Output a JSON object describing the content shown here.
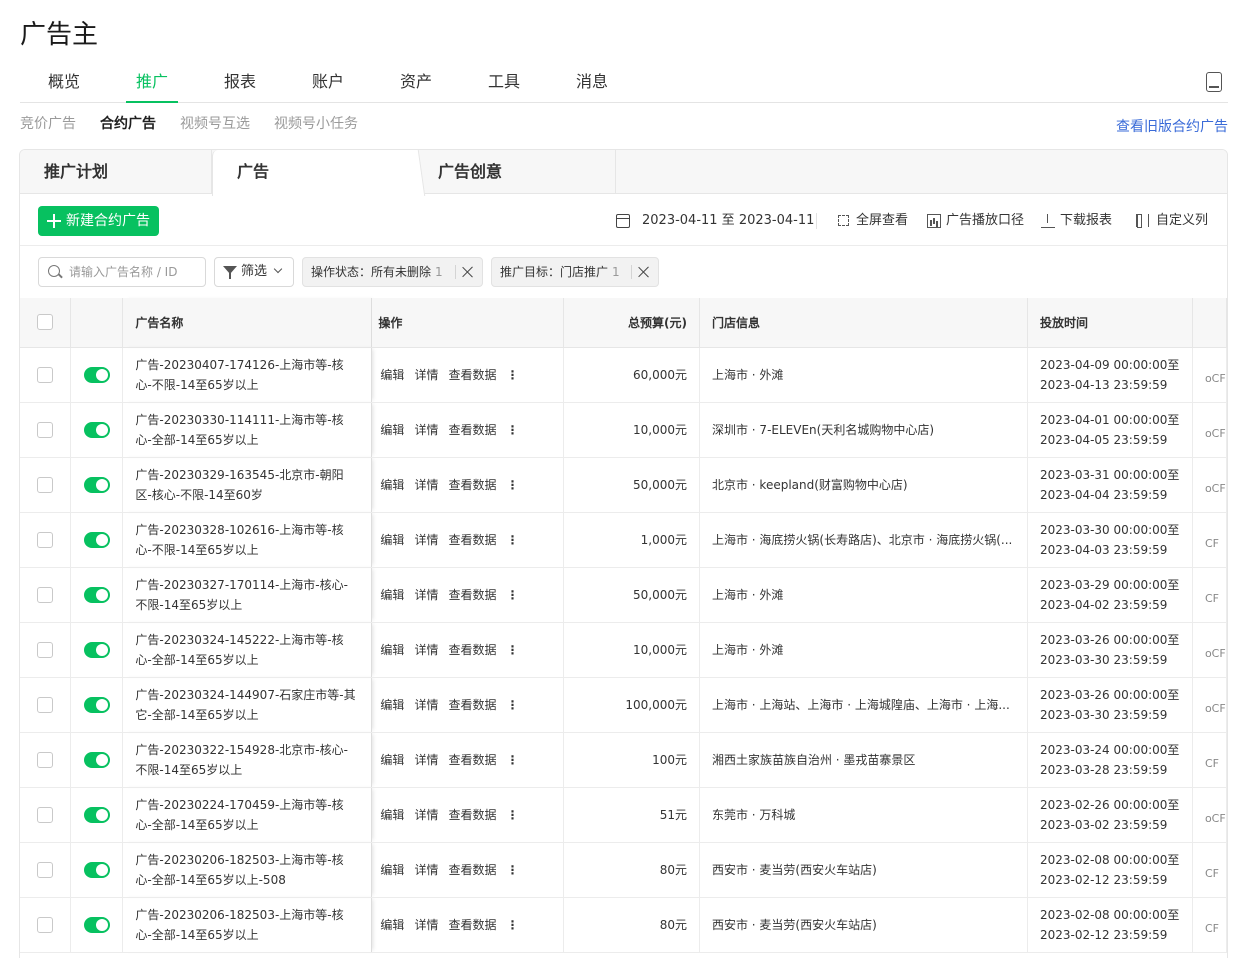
{
  "app_title": "广告主",
  "main_nav": [
    "概览",
    "推广",
    "报表",
    "账户",
    "资产",
    "工具",
    "消息"
  ],
  "sub_nav": [
    "竞价广告",
    "合约广告",
    "视频号互选",
    "视频号小任务"
  ],
  "old_link": "查看旧版合约广告",
  "tabs": [
    "推广计划",
    "广告",
    "广告创意"
  ],
  "toolbar": {
    "new_button": "新建合约广告",
    "date_range": "2023-04-11 至 2023-04-11",
    "fullscreen": "全屏查看",
    "playback": "广告播放口径",
    "download": "下载报表",
    "custom_cols": "自定义列"
  },
  "filters": {
    "search_placeholder": "请输入广告名称 / ID",
    "filter_label": "筛选",
    "tag1_label": "操作状态：所有未删除",
    "tag1_count": "1",
    "tag2_label": "推广目标：门店推广",
    "tag2_count": "1"
  },
  "columns": {
    "name": "广告名称",
    "ops": "操作",
    "budget": "总预算(元)",
    "store": "门店信息",
    "time": "投放时间"
  },
  "ops_labels": [
    "编辑",
    "详情",
    "查看数据",
    "⋮"
  ],
  "rows": [
    {
      "name": "广告-20230407-174126-上海市等-核心-不限-14至65岁以上",
      "budget": "60,000元",
      "store": "上海市 · 外滩",
      "start": "2023-04-09 00:00:00至",
      "end": "2023-04-13 23:59:59",
      "tail": "oCF"
    },
    {
      "name": "广告-20230330-114111-上海市等-核心-全部-14至65岁以上",
      "budget": "10,000元",
      "store": "深圳市 · 7-ELEVEn(天利名城购物中心店)",
      "start": "2023-04-01 00:00:00至",
      "end": "2023-04-05 23:59:59",
      "tail": "oCF"
    },
    {
      "name": "广告-20230329-163545-北京市-朝阳区-核心-不限-14至60岁",
      "budget": "50,000元",
      "store": "北京市 · keepland(财富购物中心店)",
      "start": "2023-03-31 00:00:00至",
      "end": "2023-04-04 23:59:59",
      "tail": "oCF"
    },
    {
      "name": "广告-20230328-102616-上海市等-核心-不限-14至65岁以上",
      "budget": "1,000元",
      "store": "上海市 · 海底捞火锅(长寿路店)、北京市 · 海底捞火锅(...",
      "start": "2023-03-30 00:00:00至",
      "end": "2023-04-03 23:59:59",
      "tail": "CF"
    },
    {
      "name": "广告-20230327-170114-上海市-核心-不限-14至65岁以上",
      "budget": "50,000元",
      "store": "上海市 · 外滩",
      "start": "2023-03-29 00:00:00至",
      "end": "2023-04-02 23:59:59",
      "tail": "CF"
    },
    {
      "name": "广告-20230324-145222-上海市等-核心-全部-14至65岁以上",
      "budget": "10,000元",
      "store": "上海市 · 外滩",
      "start": "2023-03-26 00:00:00至",
      "end": "2023-03-30 23:59:59",
      "tail": "oCF"
    },
    {
      "name": "广告-20230324-144907-石家庄市等-其它-全部-14至65岁以上",
      "budget": "100,000元",
      "store": "上海市 · 上海站、上海市 · 上海城隍庙、上海市 · 上海...",
      "start": "2023-03-26 00:00:00至",
      "end": "2023-03-30 23:59:59",
      "tail": "oCF"
    },
    {
      "name": "广告-20230322-154928-北京市-核心-不限-14至65岁以上",
      "budget": "100元",
      "store": "湘西土家族苗族自治州 · 墨戎苗寨景区",
      "start": "2023-03-24 00:00:00至",
      "end": "2023-03-28 23:59:59",
      "tail": "CF"
    },
    {
      "name": "广告-20230224-170459-上海市等-核心-全部-14至65岁以上",
      "budget": "51元",
      "store": "东莞市 · 万科城",
      "start": "2023-02-26 00:00:00至",
      "end": "2023-03-02 23:59:59",
      "tail": "oCF"
    },
    {
      "name": "广告-20230206-182503-上海市等-核心-全部-14至65岁以上-508",
      "budget": "80元",
      "store": "西安市 · 麦当劳(西安火车站店)",
      "start": "2023-02-08 00:00:00至",
      "end": "2023-02-12 23:59:59",
      "tail": "CF"
    },
    {
      "name": "广告-20230206-182503-上海市等-核心-全部-14至65岁以上",
      "budget": "80元",
      "store": "西安市 · 麦当劳(西安火车站店)",
      "start": "2023-02-08 00:00:00至",
      "end": "2023-02-12 23:59:59",
      "tail": "CF"
    }
  ]
}
